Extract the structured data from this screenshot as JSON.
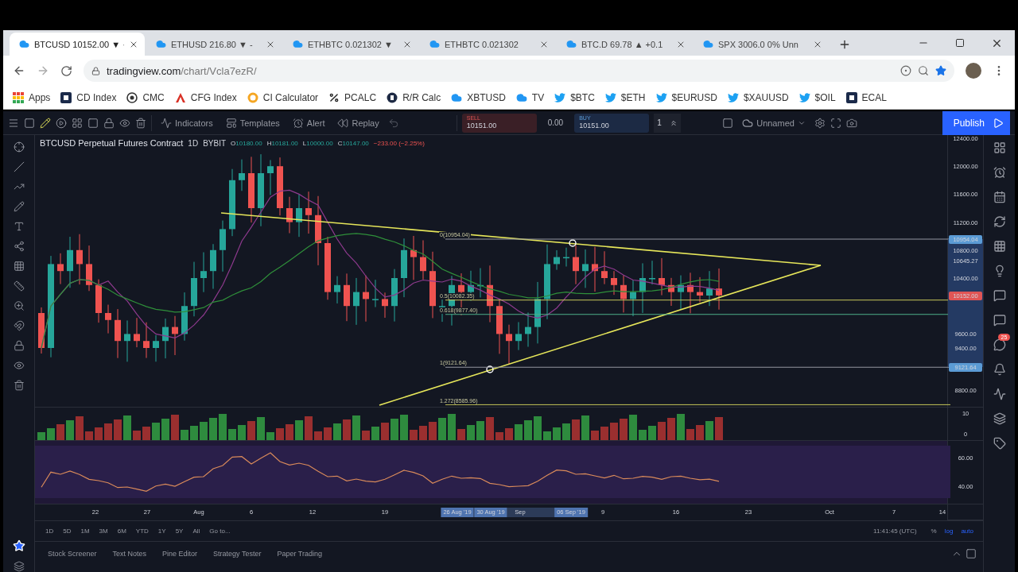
{
  "browser": {
    "tabs": [
      {
        "title": "BTCUSD 10152.00 ▼ ·",
        "selected": true
      },
      {
        "title": "ETHUSD 216.80 ▼ -",
        "selected": false
      },
      {
        "title": "ETHBTC 0.021302 ▼",
        "selected": false
      },
      {
        "title": "ETHBTC 0.021302",
        "selected": false
      },
      {
        "title": "BTC.D 69.78 ▲ +0.1",
        "selected": false
      },
      {
        "title": "SPX 3006.0 0% Unn",
        "selected": false
      }
    ],
    "url": {
      "host": "tradingview.com",
      "path": "/chart/Vcla7ezR/"
    },
    "bookmarks": [
      {
        "label": "Apps",
        "kind": "apps"
      },
      {
        "label": "CD Index",
        "kind": "tile"
      },
      {
        "label": "CMC",
        "kind": "ring"
      },
      {
        "label": "CFG Index",
        "kind": "letter"
      },
      {
        "label": "CI Calculator",
        "kind": "coin"
      },
      {
        "label": "PCALC",
        "kind": "percent"
      },
      {
        "label": "R/R Calc",
        "kind": "disc"
      },
      {
        "label": "XBTUSD",
        "kind": "cloud"
      },
      {
        "label": "TV",
        "kind": "cloud"
      },
      {
        "label": "$BTC",
        "kind": "bird"
      },
      {
        "label": "$ETH",
        "kind": "bird"
      },
      {
        "label": "$EURUSD",
        "kind": "bird"
      },
      {
        "label": "$XAUUSD",
        "kind": "bird"
      },
      {
        "label": "$OIL",
        "kind": "bird"
      },
      {
        "label": "ECAL",
        "kind": "tile"
      }
    ]
  },
  "toolbar": {
    "items": [
      {
        "label": "Indicators",
        "kind": "indicators"
      },
      {
        "label": "Templates",
        "kind": "templates"
      },
      {
        "label": "Alert",
        "kind": "alert"
      },
      {
        "label": "Replay",
        "kind": "replay"
      }
    ],
    "sell": {
      "label": "SELL",
      "price": "10151.00"
    },
    "spread": "0.00",
    "buy": {
      "label": "BUY",
      "price": "10151.00"
    },
    "quantity": "1",
    "layout_name": "Unnamed",
    "publish": "Publish"
  },
  "legend": {
    "title": "BTCUSD Perpetual Futures Contract",
    "interval": "1D",
    "exchange": "BYBIT",
    "values": [
      {
        "key": "O",
        "value": "10180.00"
      },
      {
        "key": "H",
        "value": "10181.00"
      },
      {
        "key": "L",
        "value": "10000.00"
      },
      {
        "key": "C",
        "value": "10147.00"
      }
    ],
    "change": "−233.00 (−2.25%)"
  },
  "fib_levels": [
    {
      "label": "0(10954.04)"
    },
    {
      "label": "0.5(10082.35)"
    },
    {
      "label": "0.618(9877.40)"
    },
    {
      "label": "1(9121.64)"
    },
    {
      "label": "1.272(8585.96)"
    }
  ],
  "price_axis": [
    {
      "text": "12400.00",
      "kind": "tick"
    },
    {
      "text": "12000.00",
      "kind": "tick"
    },
    {
      "text": "11600.00",
      "kind": "tick"
    },
    {
      "text": "11200.00",
      "kind": "tick"
    },
    {
      "text": "10954.04",
      "kind": "marker",
      "color": "#5b9bd5"
    },
    {
      "text": "10800.00",
      "kind": "tick"
    },
    {
      "text": "10645.27",
      "kind": "tick"
    },
    {
      "text": "10400.00",
      "kind": "tick"
    },
    {
      "text": "10152.00",
      "kind": "marker",
      "color": "#e05555"
    },
    {
      "text": "9600.00",
      "kind": "tick"
    },
    {
      "text": "9400.00",
      "kind": "tick"
    },
    {
      "text": "9121.64",
      "kind": "marker",
      "color": "#5b9bd5"
    },
    {
      "text": "8800.00",
      "kind": "tick"
    }
  ],
  "volume_axis": [
    "10",
    "0"
  ],
  "rsi_axis": [
    "60.00",
    "40.00"
  ],
  "time_axis": [
    {
      "text": "22",
      "highlighted": false
    },
    {
      "text": "27",
      "highlighted": false
    },
    {
      "text": "Aug",
      "highlighted": false
    },
    {
      "text": "6",
      "highlighted": false
    },
    {
      "text": "12",
      "highlighted": false
    },
    {
      "text": "19",
      "highlighted": false
    },
    {
      "text": "26 Aug '19",
      "highlighted": true
    },
    {
      "text": "30 Aug '19",
      "highlighted": true
    },
    {
      "text": "Sep",
      "highlighted": false
    },
    {
      "text": "06 Sep '19",
      "highlighted": true
    },
    {
      "text": "9",
      "highlighted": false
    },
    {
      "text": "16",
      "highlighted": false
    },
    {
      "text": "23",
      "highlighted": false
    },
    {
      "text": "Oct",
      "highlighted": false
    },
    {
      "text": "7",
      "highlighted": false
    },
    {
      "text": "14",
      "highlighted": false
    }
  ],
  "ranges": [
    "1D",
    "5D",
    "1M",
    "3M",
    "6M",
    "YTD",
    "1Y",
    "5Y",
    "All"
  ],
  "goto": "Go to...",
  "clock": "11:41:45 (UTC)",
  "scale_buttons": [
    {
      "label": "%",
      "selected": false
    },
    {
      "label": "log",
      "selected": true
    },
    {
      "label": "auto",
      "selected": true
    }
  ],
  "sidebar_badge": "25",
  "bottom_tabs": [
    "Stock Screener",
    "Text Notes",
    "Pine Editor",
    "Strategy Tester",
    "Paper Trading"
  ]
}
